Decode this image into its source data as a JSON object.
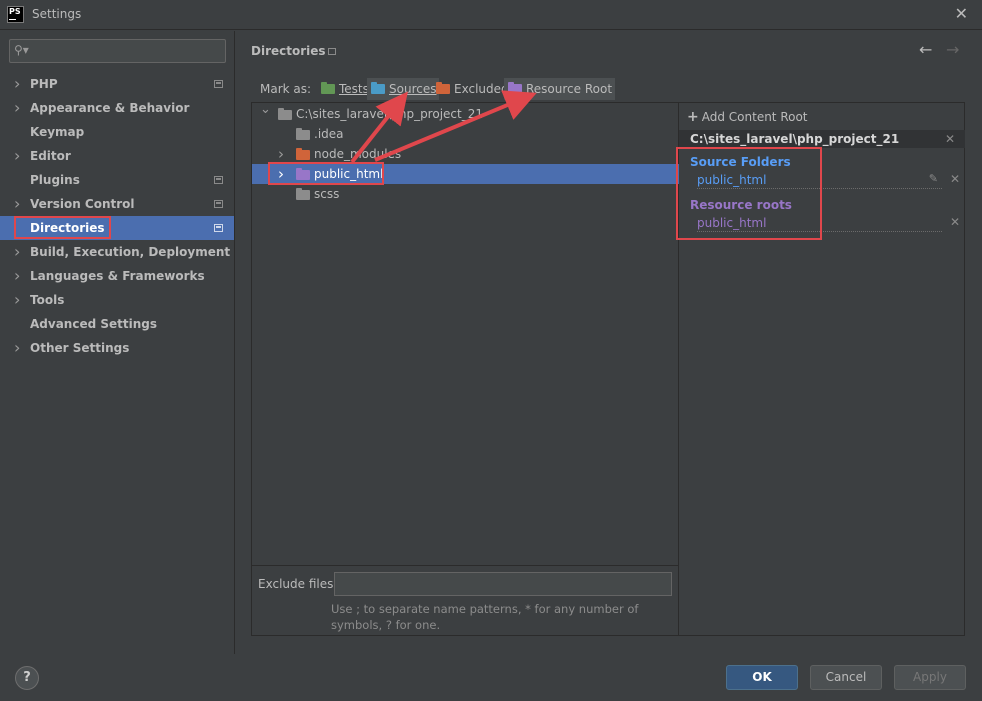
{
  "window": {
    "title": "Settings",
    "logo_text": "PS",
    "close_icon": "close-icon"
  },
  "sidebar": {
    "search_placeholder": "",
    "items": [
      {
        "label": "PHP",
        "expandable": true,
        "has_config": true
      },
      {
        "label": "Appearance & Behavior",
        "expandable": true,
        "has_config": false
      },
      {
        "label": "Keymap",
        "expandable": false,
        "has_config": false
      },
      {
        "label": "Editor",
        "expandable": true,
        "has_config": false
      },
      {
        "label": "Plugins",
        "expandable": false,
        "has_config": true
      },
      {
        "label": "Version Control",
        "expandable": true,
        "has_config": true
      },
      {
        "label": "Directories",
        "expandable": false,
        "has_config": true,
        "selected": true
      },
      {
        "label": "Build, Execution, Deployment",
        "expandable": true,
        "has_config": false
      },
      {
        "label": "Languages & Frameworks",
        "expandable": true,
        "has_config": false
      },
      {
        "label": "Tools",
        "expandable": true,
        "has_config": false
      },
      {
        "label": "Advanced Settings",
        "expandable": false,
        "has_config": false
      },
      {
        "label": "Other Settings",
        "expandable": true,
        "has_config": false
      }
    ]
  },
  "main": {
    "title": "Directories",
    "mark_as": {
      "label": "Mark as:",
      "buttons": [
        {
          "label": "Tests",
          "color": "#629755"
        },
        {
          "label": "Sources",
          "color": "#4a9bc7",
          "pressed": true
        },
        {
          "label": "Excluded",
          "color": "#d0643a"
        },
        {
          "label": "Resource Root",
          "color": "#9876c8",
          "pressed": true
        }
      ]
    },
    "tree": [
      {
        "label": "C:\\sites_laravel\\php_project_21",
        "level": 0,
        "expanded": true,
        "color": "#8c8c8c"
      },
      {
        "label": ".idea",
        "level": 1,
        "color": "#8c8c8c"
      },
      {
        "label": "node_modules",
        "level": 1,
        "collapsed": true,
        "color": "#d0643a"
      },
      {
        "label": "public_html",
        "level": 1,
        "collapsed": true,
        "color": "#9876c8",
        "selected": true
      },
      {
        "label": "scss",
        "level": 1,
        "color": "#8c8c8c"
      }
    ],
    "exclude_files": {
      "label": "Exclude files:",
      "value": "",
      "hint": "Use ; to separate name patterns, * for any number of symbols, ? for one."
    }
  },
  "content_root": {
    "add_label": "Add Content Root",
    "path": "C:\\sites_laravel\\php_project_21",
    "source_folders": {
      "label": "Source Folders",
      "color": "#589df6",
      "items": [
        "public_html"
      ]
    },
    "resource_roots": {
      "label": "Resource roots",
      "color": "#9876c8",
      "items": [
        "public_html"
      ]
    }
  },
  "footer": {
    "help": "?",
    "ok": "OK",
    "cancel": "Cancel",
    "apply": "Apply"
  }
}
